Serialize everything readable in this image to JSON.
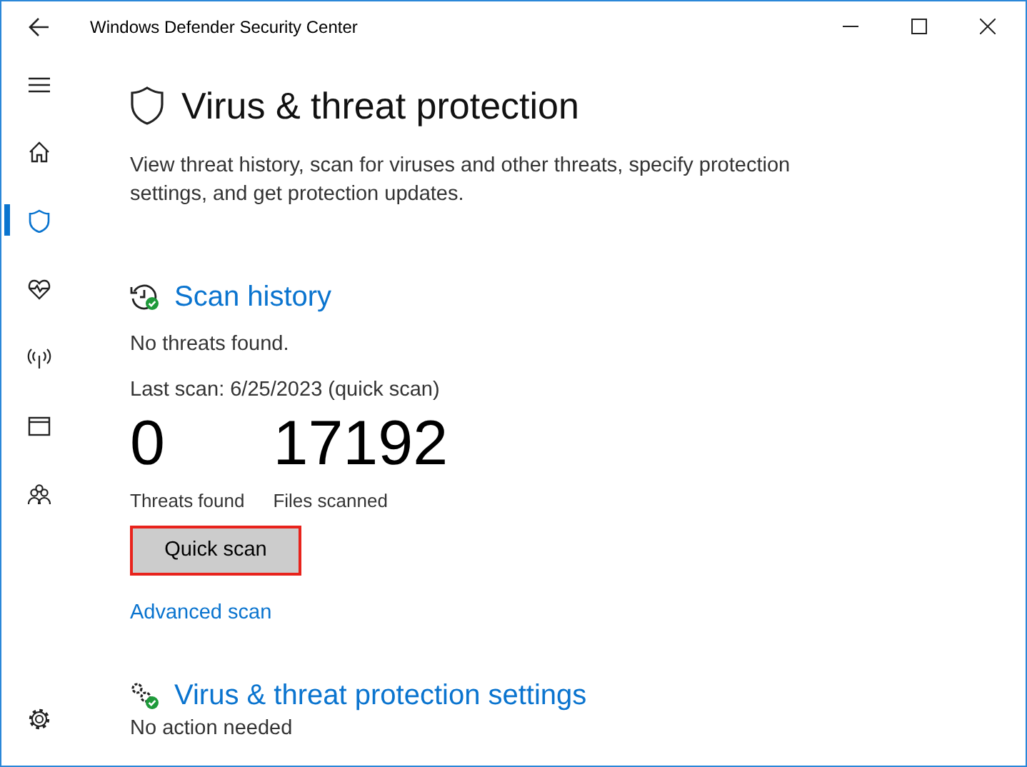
{
  "window": {
    "title": "Windows Defender Security Center"
  },
  "sidebar": {
    "items": [
      {
        "kind": "menu",
        "selected": false
      },
      {
        "kind": "home",
        "selected": false
      },
      {
        "kind": "shield",
        "selected": true
      },
      {
        "kind": "health",
        "selected": false
      },
      {
        "kind": "network",
        "selected": false
      },
      {
        "kind": "app",
        "selected": false
      },
      {
        "kind": "family",
        "selected": false
      }
    ],
    "footer": {
      "kind": "settings"
    }
  },
  "page": {
    "title": "Virus & threat protection",
    "description": "View threat history, scan for viruses and other threats, specify protection settings, and get protection updates."
  },
  "scan_history": {
    "title": "Scan history",
    "status": "No threats found.",
    "last_scan": "Last scan: 6/25/2023 (quick scan)",
    "stats": [
      {
        "value": "0",
        "label": "Threats found"
      },
      {
        "value": "17192",
        "label": "Files scanned"
      }
    ],
    "button": "Quick scan",
    "link": "Advanced scan"
  },
  "settings_section": {
    "title": "Virus & threat protection settings",
    "status": "No action needed"
  }
}
